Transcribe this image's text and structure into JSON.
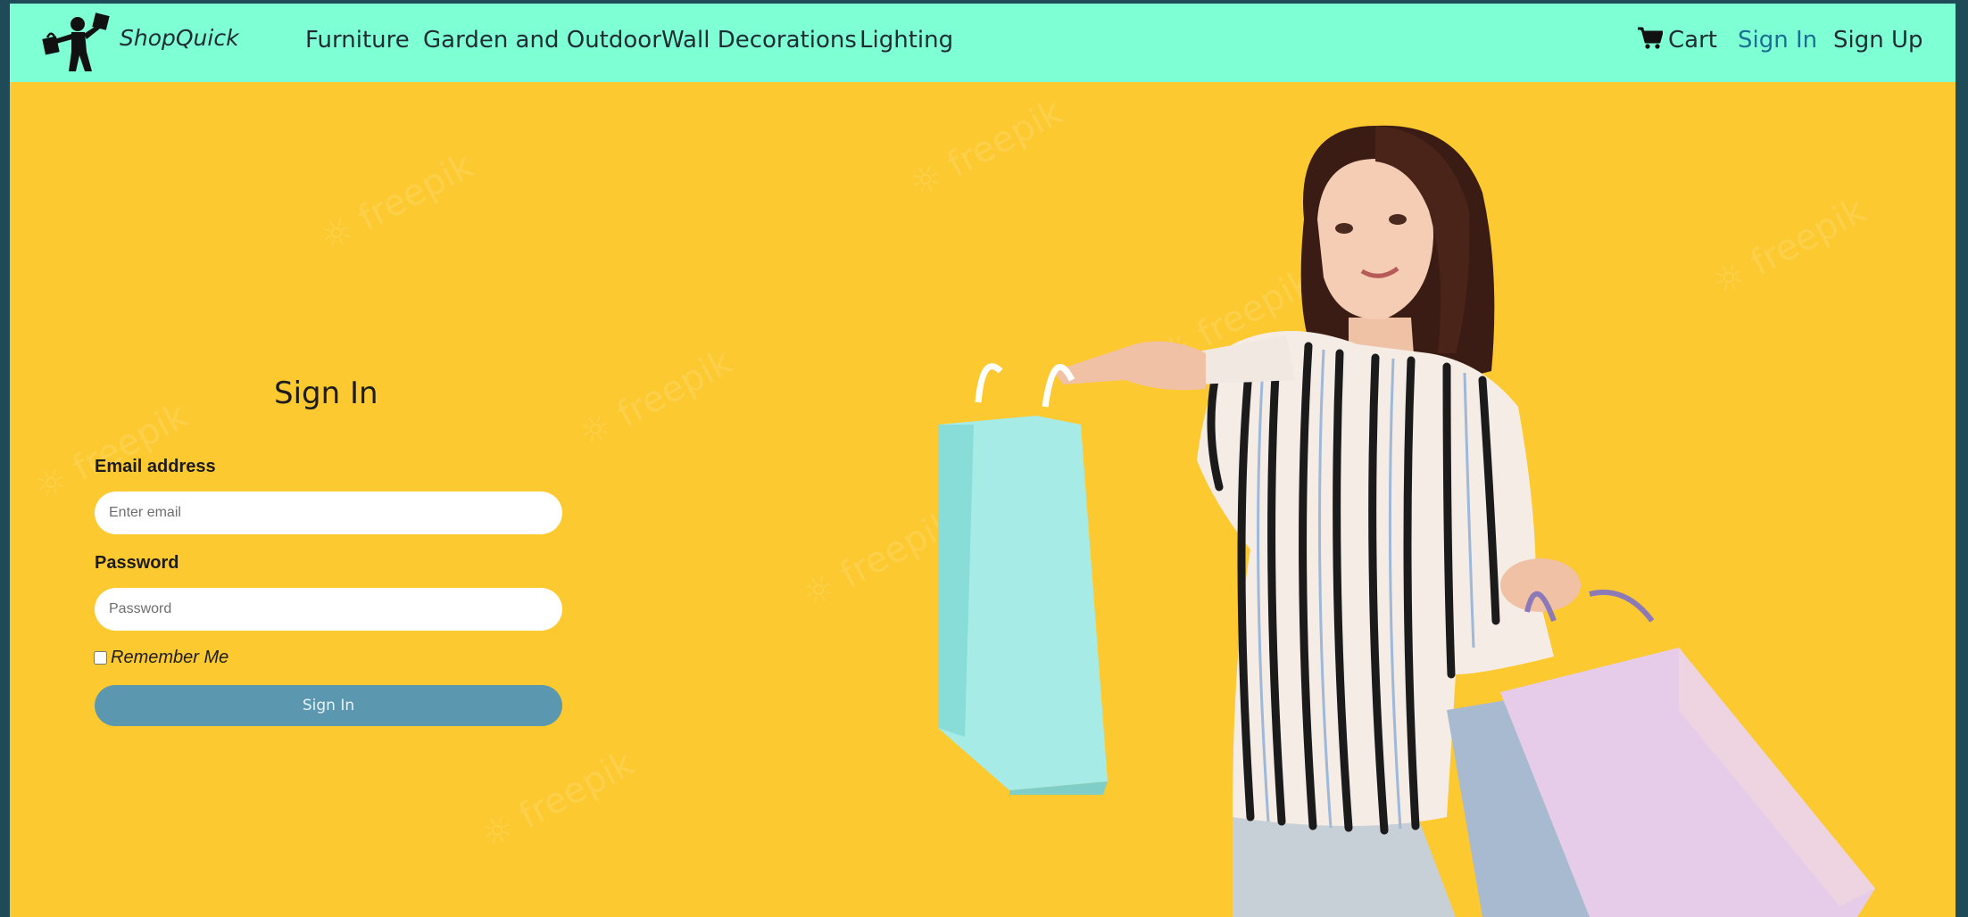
{
  "brand": {
    "name": "ShopQuick",
    "logo_icon": "shopper-with-bags-icon"
  },
  "nav": {
    "links": [
      "Furniture",
      "Garden and Outdoor",
      "Wall Decorations",
      "Lighting"
    ],
    "cart_icon": "shopping-cart-icon",
    "cart_label": "Cart",
    "signin_label": "Sign In",
    "signup_label": "Sign Up"
  },
  "form": {
    "title": "Sign In",
    "email_label": "Email address",
    "email_placeholder": "Enter email",
    "password_label": "Password",
    "password_placeholder": "Password",
    "remember_label": "Remember Me",
    "submit_label": "Sign In"
  },
  "colors": {
    "navbar_bg": "#7fffd4",
    "page_bg": "#fcc930",
    "button_bg": "#5b98b0",
    "active_link": "#1b6f93"
  }
}
